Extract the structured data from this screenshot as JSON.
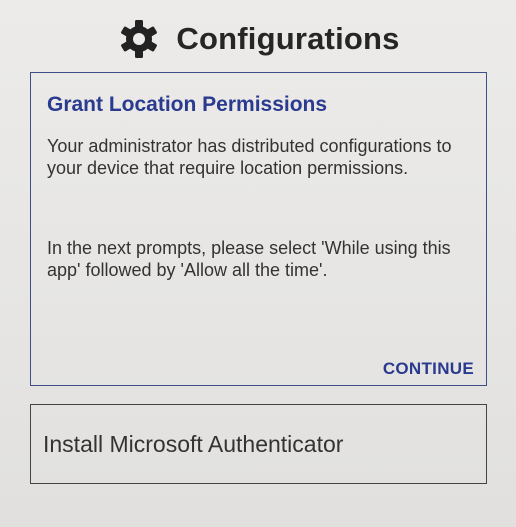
{
  "header": {
    "title": "Configurations",
    "icon": "gear-icon"
  },
  "permission_card": {
    "title": "Grant Location Permissions",
    "paragraph1": "Your administrator has distributed configurations to your device that require location permissions.",
    "paragraph2": "In the next prompts, please select 'While using this app' followed by 'Allow all the time'.",
    "continue_label": "CONTINUE",
    "accent_color": "#2a3b8f"
  },
  "list": {
    "items": [
      {
        "label": "Install Microsoft Authenticator"
      }
    ]
  }
}
